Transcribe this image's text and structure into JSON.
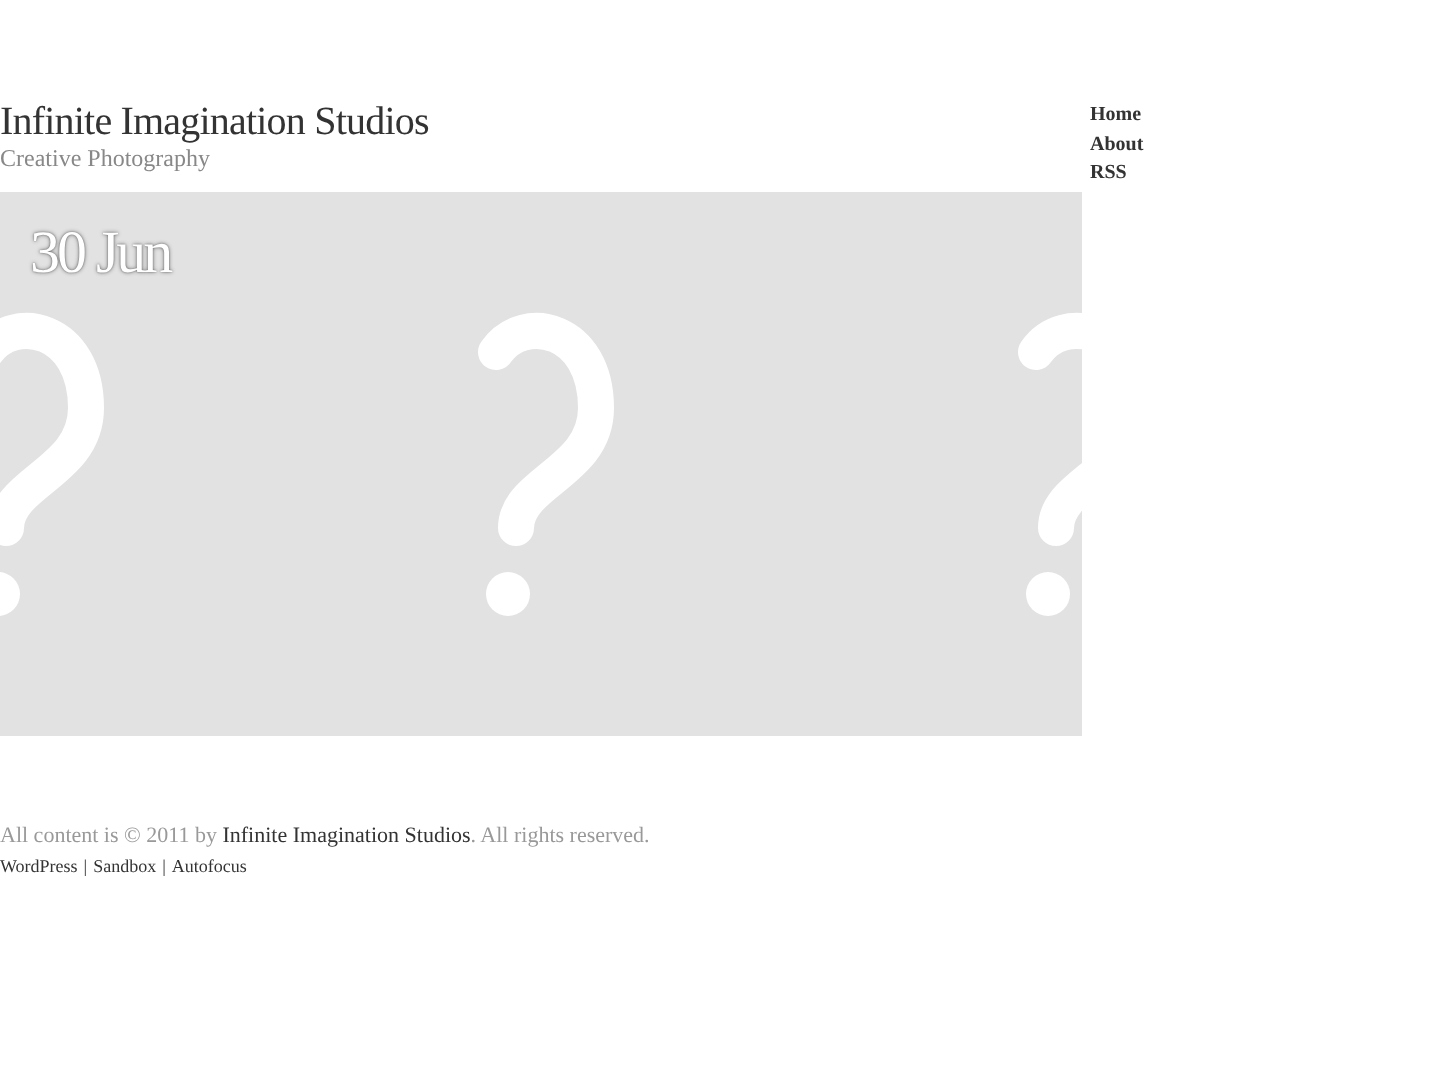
{
  "site": {
    "title": "Infinite Imagination Studios",
    "tagline": "Creative Photography"
  },
  "nav": [
    {
      "label": "Home"
    },
    {
      "label": "About"
    },
    {
      "label": "RSS"
    }
  ],
  "post": {
    "date": "30 Jun"
  },
  "footer": {
    "before": "All content is © 2011 by ",
    "link": "Infinite Imagination Studios",
    "after": ". All rights reserved.",
    "separator": "|",
    "links": [
      {
        "label": "WordPress"
      },
      {
        "label": "Sandbox"
      },
      {
        "label": "Autofocus"
      }
    ]
  }
}
